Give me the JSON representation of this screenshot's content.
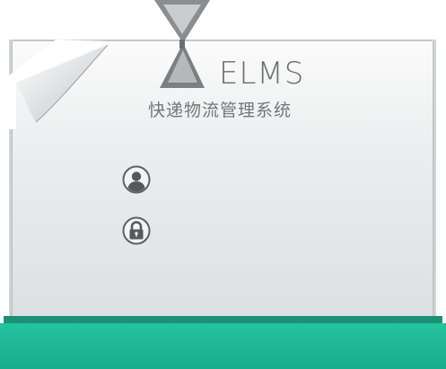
{
  "app": {
    "brand_name": "ELMS",
    "subtitle": "快递物流管理系统"
  },
  "form": {
    "username_icon": "user-icon",
    "password_icon": "lock-icon"
  },
  "colors": {
    "accent": "#1fb896",
    "text": "#6a6e71"
  }
}
